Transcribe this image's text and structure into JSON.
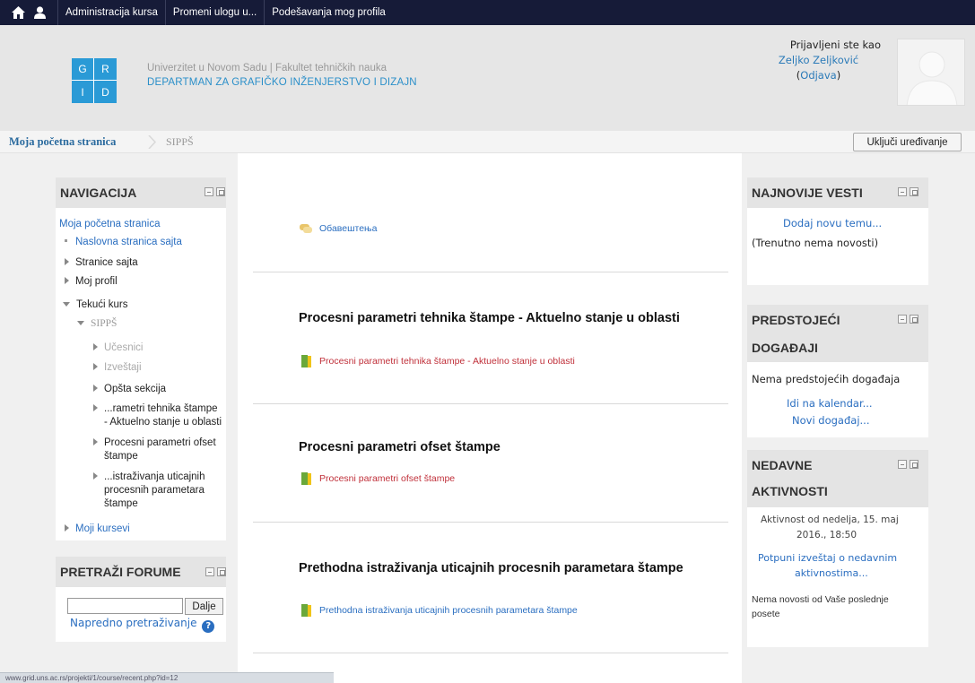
{
  "topbar": {
    "links": [
      "Administracija kursa",
      "Promeni ulogu u...",
      "Podešavanja mog profila"
    ]
  },
  "header": {
    "logo_letters": [
      "G",
      "R",
      "I",
      "D"
    ],
    "university": "Univerzitet u Novom Sadu  |  Fakultet tehničkih nauka",
    "department": "DEPARTMAN ZA GRAFIČKO INŽENJERSTVO I DIZAJN",
    "logged_in_label": "Prijavljeni ste kao",
    "user_name": "Zeljko Zeljković",
    "logout_open": "(",
    "logout_label": "Odjava",
    "logout_close": ")"
  },
  "breadcrumb": {
    "home": "Moja početna stranica",
    "current": "SIPPŠ"
  },
  "edit_button": "Uključi uređivanje",
  "navigation": {
    "title": "NAVIGACIJA",
    "items": [
      {
        "label": "Moja početna stranica"
      },
      {
        "label": "Naslovna stranica sajta"
      },
      {
        "label": "Stranice sajta"
      },
      {
        "label": "Moj profil"
      },
      {
        "label": "Tekući kurs"
      },
      {
        "label": "SIPPŠ"
      },
      {
        "label": "Učesnici"
      },
      {
        "label": "Izveštaji"
      },
      {
        "label": "Opšta sekcija"
      },
      {
        "label": "...rametri tehnika štampe"
      },
      {
        "label": "- Aktuelno stanje u oblasti"
      },
      {
        "label": "Procesni parametri ofset"
      },
      {
        "label": "štampe"
      },
      {
        "label": "...istraživanja uticajnih"
      },
      {
        "label": "procesnih parametara"
      },
      {
        "label": "štampe"
      },
      {
        "label": "Moji kursevi"
      }
    ]
  },
  "search_forums": {
    "title": "PRETRAŽI FORUME",
    "button": "Dalje",
    "advanced": "Napredno pretraživanje",
    "help": "?"
  },
  "status_url": "www.grid.uns.ac.rs/projekti/1/course/recent.php?id=12",
  "sections": [
    {
      "activity": "Обавештења"
    },
    {
      "title": "Procesni parametri tehnika štampe - Aktuelno stanje u oblasti",
      "activity": "Procesni parametri tehnika štampe - Aktuelno stanje u oblasti"
    },
    {
      "title": "Procesni parametri ofset štampe",
      "activity": "Procesni parametri ofset štampe"
    },
    {
      "title": "Prethodna istraživanja uticajnih procesnih parametara štampe",
      "activity": "Prethodna istraživanja uticajnih procesnih parametara štampe"
    }
  ],
  "news": {
    "title": "NAJNOVIJE VESTI",
    "add_link": "Dodaj novu temu...",
    "empty": "(Trenutno nema novosti)"
  },
  "events": {
    "title_line1": "PREDSTOJEĆI",
    "title_line2": "DOGAĐAJI",
    "empty": "Nema predstojećih događaja",
    "calendar_link": "Idi na kalendar...",
    "new_event_link": "Novi događaj..."
  },
  "recent": {
    "title_line1": "NEDAVNE",
    "title_line2": "AKTIVNOSTI",
    "since_line1": "Aktivnost od nedelja, 15. maj",
    "since_line2": "2016., 18:50",
    "report_line1": "Potpuni izveštaj o nedavnim",
    "report_line2": "aktivnostima...",
    "none_line1": "Nema novosti od Vaše poslednje",
    "none_line2": "posete"
  }
}
